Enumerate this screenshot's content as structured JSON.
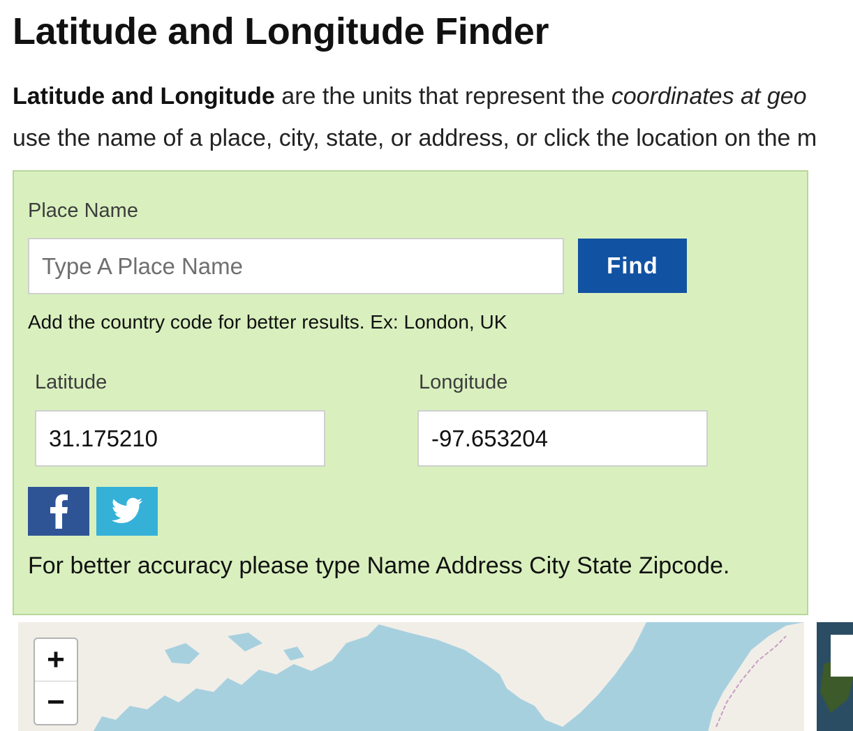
{
  "header": {
    "title": "Latitude and Longitude Finder"
  },
  "intro": {
    "bold": "Latitude and Longitude",
    "text1": " are the units that represent the ",
    "italic": "coordinates at geo",
    "line2": "use the name of a place, city, state, or address, or click the location on the m"
  },
  "finder": {
    "place_label": "Place Name",
    "place_placeholder": "Type A Place Name",
    "place_value": "",
    "find_label": "Find",
    "hint": "Add the country code for better results. Ex: London, UK",
    "latitude_label": "Latitude",
    "latitude_value": "31.175210",
    "longitude_label": "Longitude",
    "longitude_value": "-97.653204",
    "share": [
      {
        "name": "facebook",
        "icon": "facebook-icon",
        "color": "#2f5496"
      },
      {
        "name": "twitter",
        "icon": "twitter-icon",
        "color": "#35b1d8"
      }
    ],
    "accuracy_note": "For better accuracy please type Name Address City State Zipcode."
  },
  "map": {
    "zoom_in": "+",
    "zoom_out": "−",
    "water_color": "#a7d0df",
    "land_color": "#f1eee8"
  },
  "colors": {
    "panel_bg": "#d9f0be",
    "panel_border": "#b7d79a",
    "find_button": "#1252a3"
  }
}
